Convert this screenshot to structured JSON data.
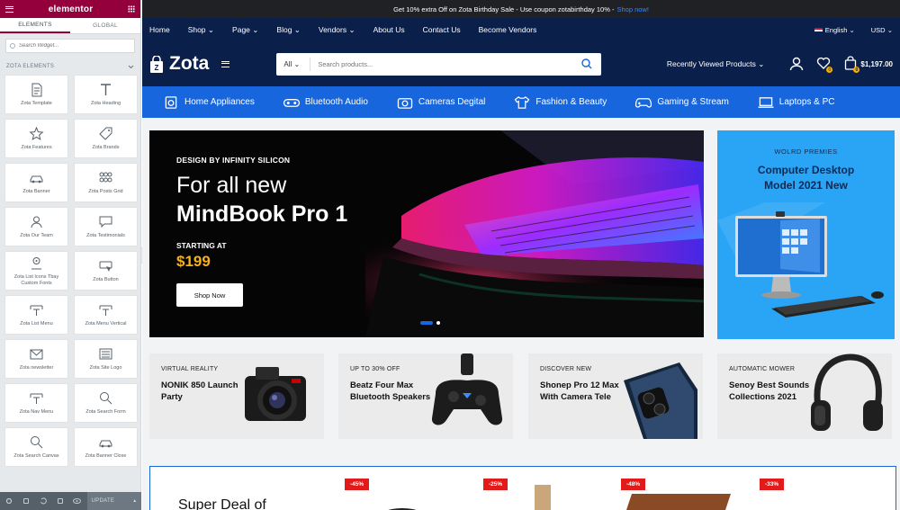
{
  "editor": {
    "logo": "elementor",
    "tabs": [
      "ELEMENTS",
      "GLOBAL"
    ],
    "search_placeholder": "Search Widget...",
    "category": "ZOTA ELEMENTS",
    "widgets": [
      {
        "label": "Zota Template",
        "icon": "document-icon"
      },
      {
        "label": "Zota Heading",
        "icon": "heading-icon"
      },
      {
        "label": "Zota Features",
        "icon": "star-icon"
      },
      {
        "label": "Zota Brands",
        "icon": "tag-icon"
      },
      {
        "label": "Zota Banner",
        "icon": "car-icon"
      },
      {
        "label": "Zota Posts Grid",
        "icon": "posts-grid-icon"
      },
      {
        "label": "Zota Our Team",
        "icon": "team-icon"
      },
      {
        "label": "Zota Testimonials",
        "icon": "speech-bubble-icon"
      },
      {
        "label": "Zota List Icons Tbay Custom Fonts",
        "icon": "pin-icon"
      },
      {
        "label": "Zota Button",
        "icon": "button-icon"
      },
      {
        "label": "Zota List Menu",
        "icon": "menu-icon"
      },
      {
        "label": "Zota Menu Vertical",
        "icon": "menu-icon"
      },
      {
        "label": "Zota newsletter",
        "icon": "envelope-icon"
      },
      {
        "label": "Zota Site Logo",
        "icon": "keyboard-icon"
      },
      {
        "label": "Zota Nav Menu",
        "icon": "menu-icon"
      },
      {
        "label": "Zota Search Form",
        "icon": "search-icon"
      },
      {
        "label": "Zota Search Canvas",
        "icon": "search-icon"
      },
      {
        "label": "Zota Banner Close",
        "icon": "car-icon"
      }
    ],
    "footer_update": "UPDATE"
  },
  "site": {
    "promo_text": "Get 10% extra Off on Zota Birthday Sale - Use coupon zotabirthday 10% -",
    "promo_link": "Shop now!",
    "topnav": [
      {
        "label": "Home",
        "arrow": false
      },
      {
        "label": "Shop",
        "arrow": true
      },
      {
        "label": "Page",
        "arrow": true
      },
      {
        "label": "Blog",
        "arrow": true
      },
      {
        "label": "Vendors",
        "arrow": true
      },
      {
        "label": "About Us",
        "arrow": false
      },
      {
        "label": "Contact Us",
        "arrow": false
      },
      {
        "label": "Become Vendors",
        "arrow": false
      }
    ],
    "language": "English",
    "currency": "USD",
    "brand": "Zota",
    "search_category": "All",
    "search_placeholder": "Search products...",
    "recently_viewed": "Recently Viewed Products",
    "wishlist_count": "0",
    "cart_count": "0",
    "cart_total": "$1,197.00",
    "categories": [
      {
        "label": "Home Appliances",
        "icon": "appliance-icon"
      },
      {
        "label": "Bluetooth Audio",
        "icon": "speaker-icon"
      },
      {
        "label": "Cameras Degital",
        "icon": "camera-icon"
      },
      {
        "label": "Fashion & Beauty",
        "icon": "shirt-icon"
      },
      {
        "label": "Gaming & Stream",
        "icon": "gamepad-icon"
      },
      {
        "label": "Laptops & PC",
        "icon": "laptop-icon"
      }
    ],
    "hero": {
      "kicker": "DESIGN BY INFINITY SILICON",
      "line1": "For all new",
      "line2": "MindBook Pro 1",
      "starting": "STARTING AT",
      "price": "$199",
      "button": "Shop Now"
    },
    "side_banner": {
      "kicker": "WOLRD PREMIES",
      "title_l1": "Computer Desktop",
      "title_l2": "Model 2021 New"
    },
    "promo_cards": [
      {
        "kicker": "VIRTUAL REALITY",
        "title": "NONIK 850 Launch Party"
      },
      {
        "kicker": "UP TO 30% OFF",
        "title": "Beatz Four Max Bluetooth Speakers"
      },
      {
        "kicker": "DISCOVER NEW",
        "title": "Shonep Pro 12 Max With Camera Tele"
      },
      {
        "kicker": "AUTOMATIC MOWER",
        "title": "Senoy Best Sounds Collections 2021"
      }
    ],
    "deal_title": "Super Deal of",
    "sale_badges": [
      "-45%",
      "-25%",
      "-48%",
      "-33%"
    ]
  },
  "colors": {
    "accent": "#1766dd",
    "navy": "#0b1f4b",
    "editor": "#93003c",
    "price": "#f6b01b",
    "sale": "#e21a1a"
  }
}
